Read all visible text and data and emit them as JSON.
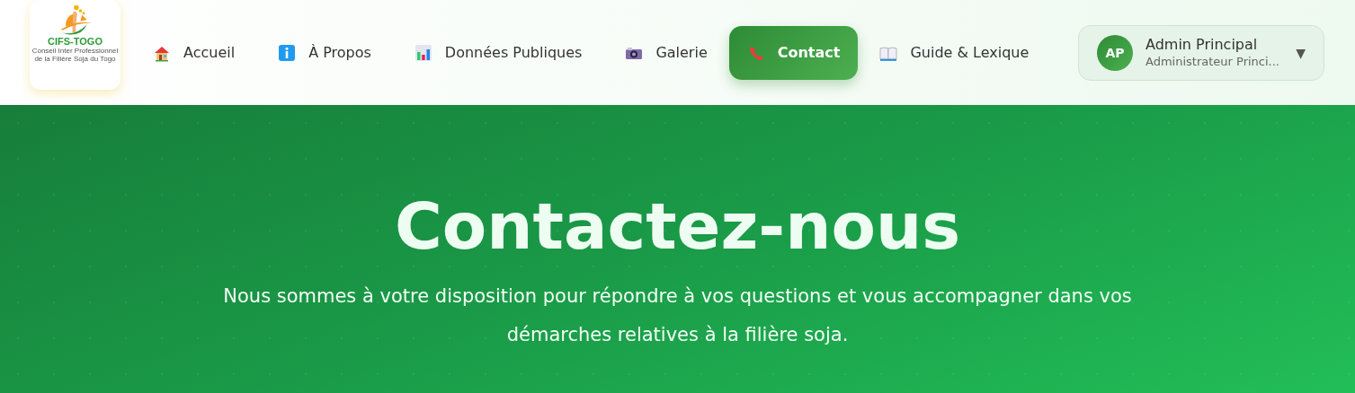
{
  "logo": {
    "name": "CIFS-TOGO",
    "subtitle": "Conseil Inter Professionnel de la Filière Soja du Togo"
  },
  "nav": [
    {
      "label": "Accueil",
      "kind": "home",
      "selected": false
    },
    {
      "label": "À Propos",
      "kind": "info",
      "selected": false
    },
    {
      "label": "Données Publiques",
      "kind": "chart",
      "selected": false
    },
    {
      "label": "Galerie",
      "kind": "camera",
      "selected": false
    },
    {
      "label": "Contact",
      "kind": "phone",
      "selected": true
    },
    {
      "label": "Guide & Lexique",
      "kind": "book",
      "selected": false
    }
  ],
  "user": {
    "initials": "AP",
    "name": "Admin Principal",
    "role": "Administrateur Princi...",
    "caret": "▼"
  },
  "hero": {
    "title": "Contactez-nous",
    "text": "Nous sommes à votre disposition pour répondre à vos questions et vous accompagner dans vos démarches relatives à la filière soja."
  }
}
